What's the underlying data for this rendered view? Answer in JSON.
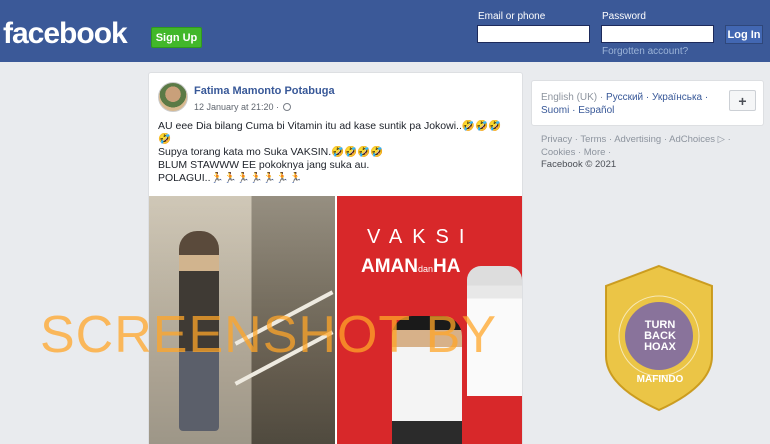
{
  "header": {
    "logo": "facebook",
    "signup_label": "Sign Up",
    "email_label": "Email or phone",
    "password_label": "Password",
    "forgot_label": "Forgotten account?",
    "login_label": "Log In",
    "colors": {
      "bar": "#3b5998",
      "signup": "#42b72a"
    }
  },
  "post": {
    "author": "Fatima Mamonto Potabuga",
    "timestamp": "12 January at 21:20 ·",
    "lines": [
      "AU eee Dia bilang Cuma bi Vitamin itu ad kase suntik pa Jokowi..🤣🤣🤣",
      "🤣",
      "Supya torang kata mo Suka VAKSIN.🤣🤣🤣🤣",
      "BLUM STAWWW EE pokoknya jang suka au.",
      "POLAGUI..🏃🏃🏃🏃🏃🏃🏃"
    ],
    "image_right_text1": "VAKSI",
    "image_right_text2": "AMAN",
    "image_right_text3": "dan",
    "image_right_text4": "HA"
  },
  "sidebar": {
    "lang_current": "English (UK) ·",
    "lang_links": [
      "Русский ·",
      "Українська ·",
      "Suomi ·",
      "Español"
    ],
    "plus_label": "+",
    "footer_links": "Privacy · Terms · Advertising · AdChoices ▷ · Cookies · More ·",
    "copyright": "Facebook © 2021"
  },
  "overlay": {
    "watermark": "SCREENSHOT BY",
    "badge_line1": "TURN",
    "badge_line2": "BACK",
    "badge_line3": "HOAX",
    "badge_bottom": "MAFINDO",
    "badge_ring": "MASYARAKAT ANTI FITNAH INDONESIA"
  }
}
